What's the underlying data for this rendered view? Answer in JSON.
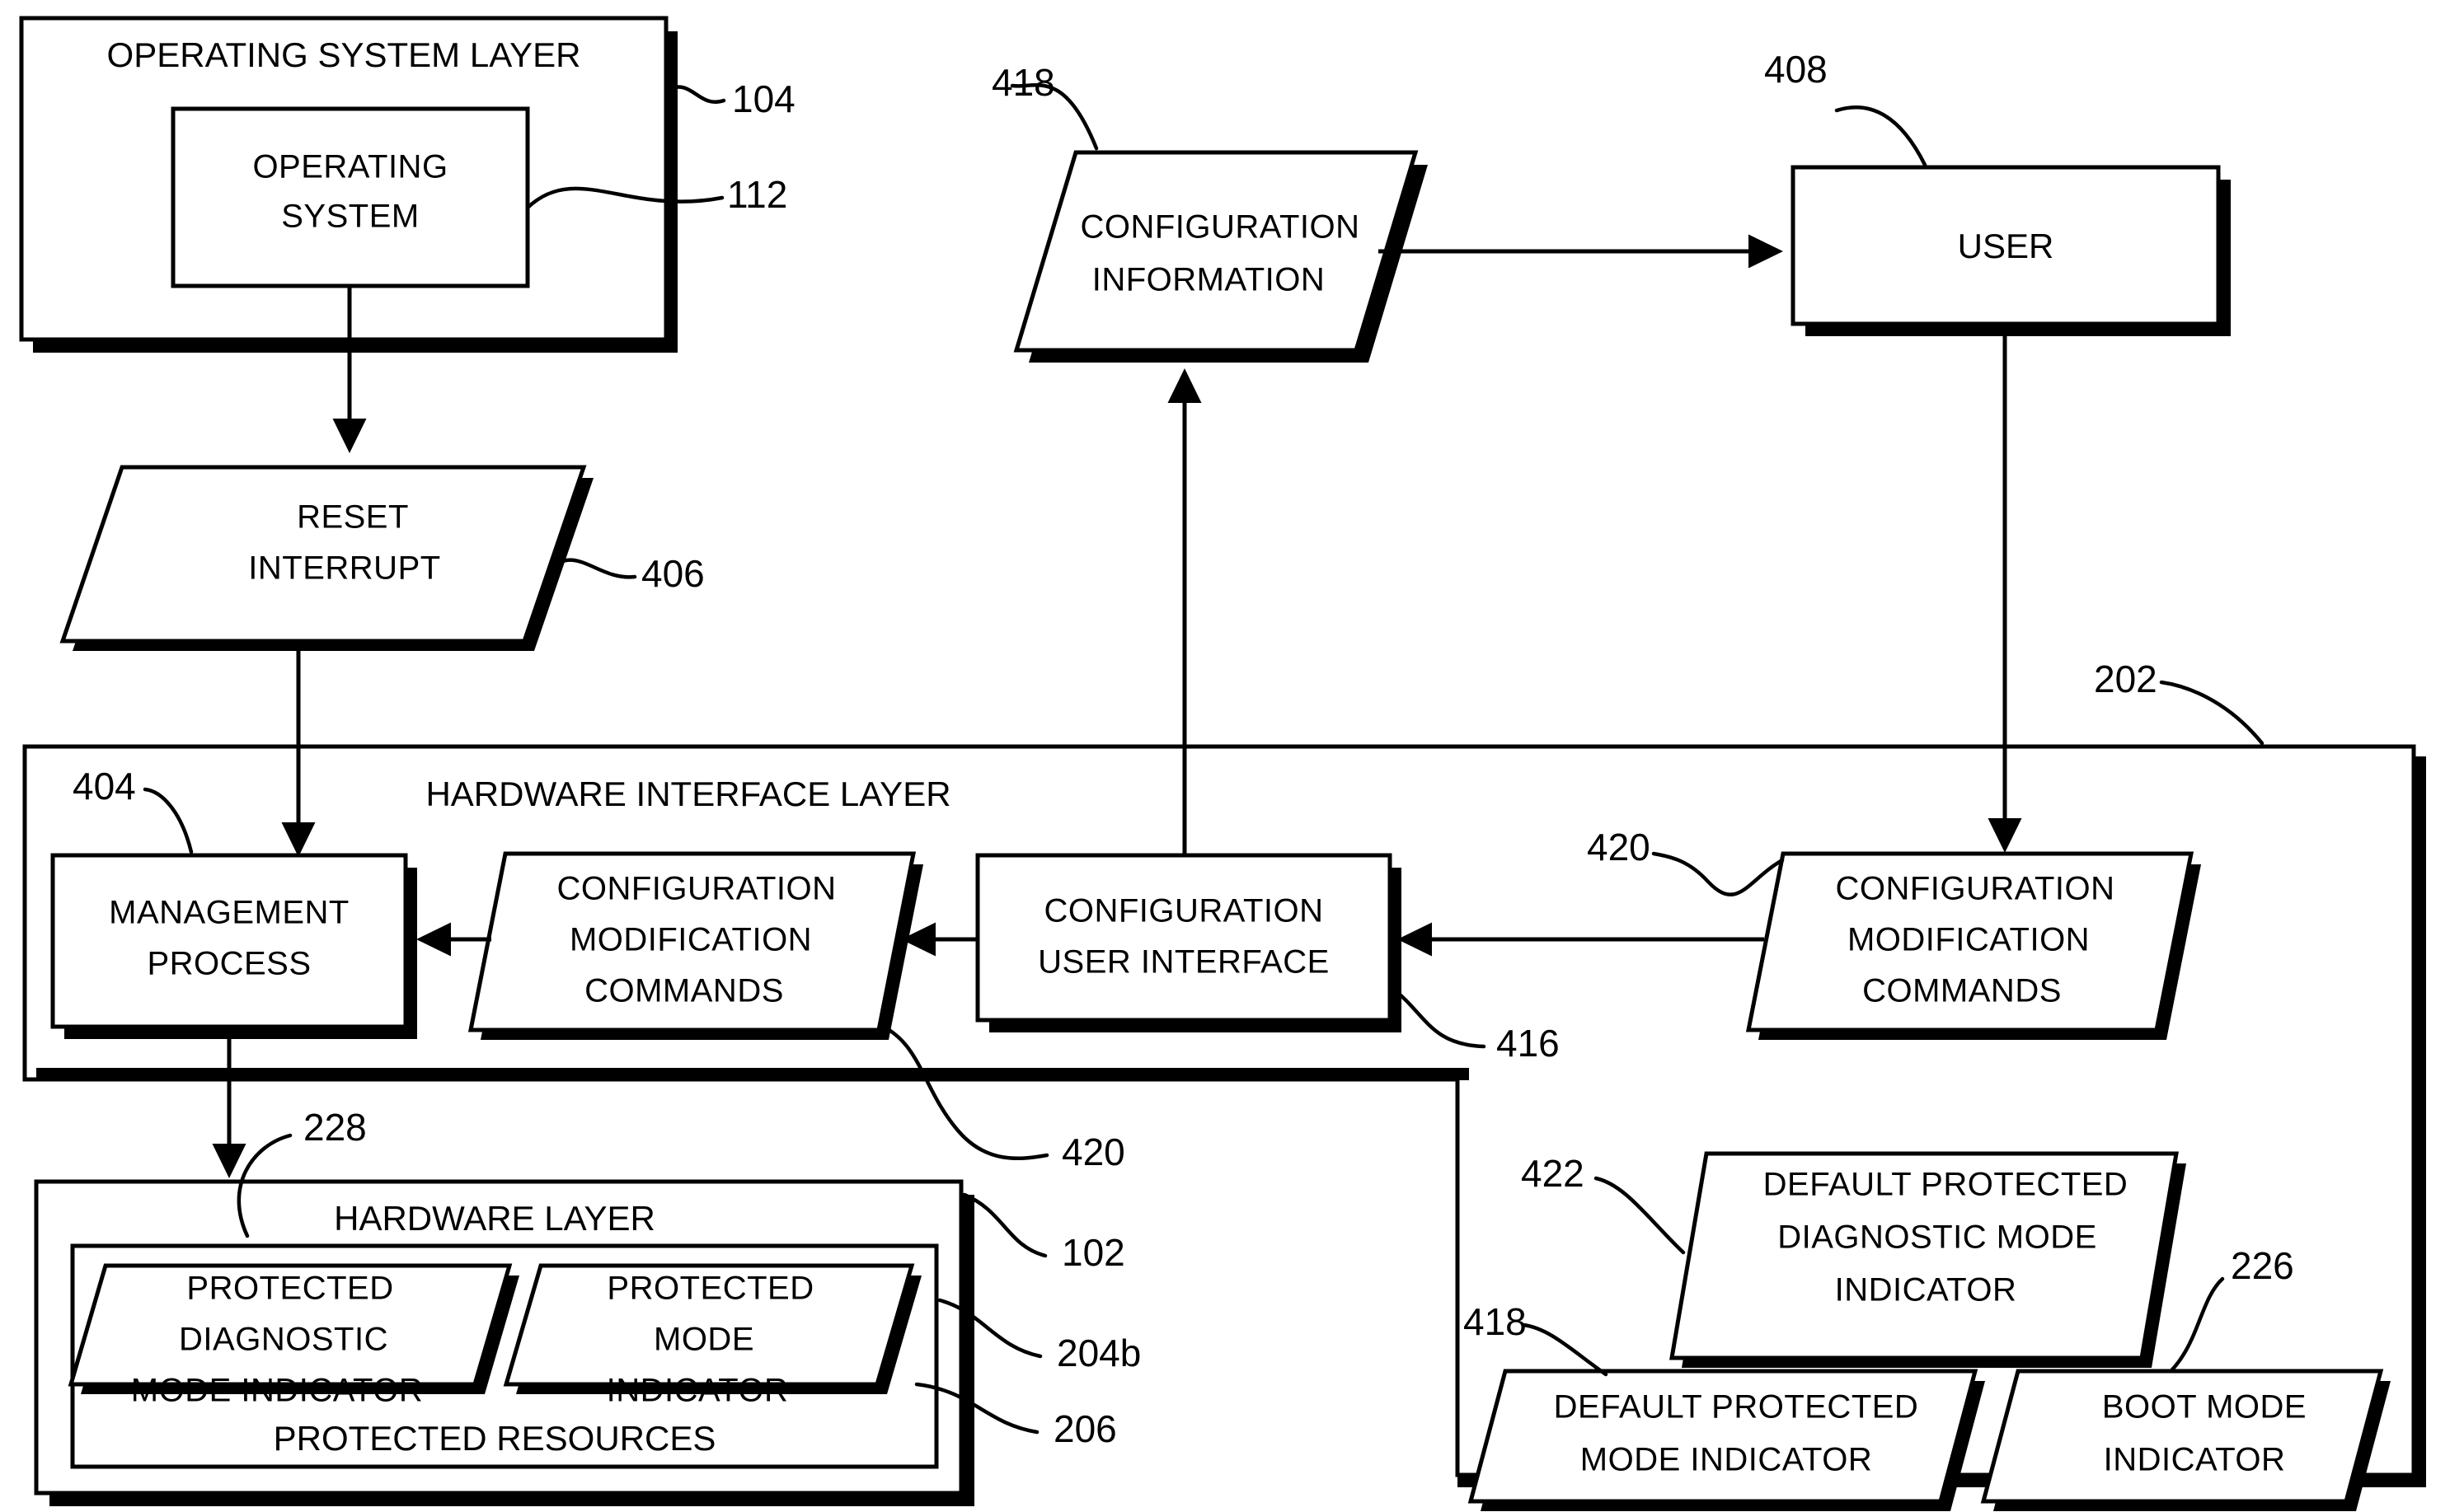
{
  "figure": {
    "type": "patent-block-diagram",
    "background_color": "#ffffff",
    "line_color": "#000000"
  },
  "blocks": {
    "operating_system_layer": {
      "label": "OPERATING SYSTEM LAYER",
      "ref": "104",
      "shape": "rectangle"
    },
    "operating_system": {
      "label_line1": "OPERATING",
      "label_line2": "SYSTEM",
      "ref": "112",
      "shape": "rectangle"
    },
    "reset_interrupt": {
      "label_line1": "RESET",
      "label_line2": "INTERRUPT",
      "ref": "406",
      "shape": "parallelogram"
    },
    "configuration_information": {
      "label_line1": "CONFIGURATION",
      "label_line2": "INFORMATION",
      "ref": "418",
      "shape": "parallelogram"
    },
    "user": {
      "label": "USER",
      "ref": "408",
      "shape": "rectangle"
    },
    "hardware_interface_layer": {
      "label": "HARDWARE INTERFACE LAYER",
      "shape": "rectangle"
    },
    "management_process": {
      "label_line1": "MANAGEMENT",
      "label_line2": "PROCESS",
      "ref": "404",
      "shape": "rectangle"
    },
    "configuration_modification_commands_inner": {
      "label_line1": "CONFIGURATION",
      "label_line2": "MODIFICATION",
      "label_line3": "COMMANDS",
      "ref": "420",
      "shape": "parallelogram"
    },
    "configuration_user_interface": {
      "label_line1": "CONFIGURATION",
      "label_line2": "USER INTERFACE",
      "ref": "416",
      "shape": "rectangle"
    },
    "configuration_modification_commands_outer": {
      "label_line1": "CONFIGURATION",
      "label_line2": "MODIFICATION",
      "label_line3": "COMMANDS",
      "ref": "420",
      "shape": "parallelogram"
    },
    "hardware_layer": {
      "label": "HARDWARE LAYER",
      "ref": "228",
      "shape": "rectangle"
    },
    "protected_resources": {
      "label": "PROTECTED RESOURCES",
      "ref": "102",
      "shape": "rectangle"
    },
    "protected_diagnostic_mode_indicator": {
      "label_line1": "PROTECTED",
      "label_line2": "DIAGNOSTIC",
      "label_line3": "MODE INDICATOR",
      "ref": "204b",
      "shape": "parallelogram"
    },
    "protected_mode_indicator": {
      "label_line1": "PROTECTED",
      "label_line2": "MODE",
      "label_line3": "INDICATOR",
      "ref": "206",
      "shape": "parallelogram"
    },
    "system_container": {
      "ref": "202",
      "shape": "rectangle"
    },
    "default_protected_diagnostic_mode_indicator": {
      "label_line1": "DEFAULT PROTECTED",
      "label_line2": "DIAGNOSTIC MODE",
      "label_line3": "INDICATOR",
      "ref": "422",
      "shape": "parallelogram"
    },
    "default_protected_mode_indicator": {
      "label_line1": "DEFAULT PROTECTED",
      "label_line2": "MODE INDICATOR",
      "ref": "418",
      "shape": "parallelogram"
    },
    "boot_mode_indicator": {
      "label_line1": "BOOT MODE",
      "label_line2": "INDICATOR",
      "ref": "226",
      "shape": "parallelogram"
    }
  },
  "reference_numerals": [
    "104",
    "112",
    "418",
    "408",
    "406",
    "202",
    "404",
    "420",
    "416",
    "228",
    "102",
    "204b",
    "206",
    "422",
    "226"
  ],
  "connections": [
    {
      "from": "operating_system",
      "to": "reset_interrupt",
      "style": "arrow-down"
    },
    {
      "from": "reset_interrupt",
      "to": "management_process",
      "style": "arrow-down"
    },
    {
      "from": "configuration_information",
      "to": "user",
      "style": "arrow-right"
    },
    {
      "from": "configuration_user_interface",
      "to": "configuration_information",
      "style": "arrow-up"
    },
    {
      "from": "user",
      "to": "configuration_modification_commands_outer",
      "style": "arrow-down"
    },
    {
      "from": "configuration_modification_commands_outer",
      "to": "configuration_user_interface",
      "style": "arrow-left"
    },
    {
      "from": "configuration_user_interface",
      "to": "configuration_modification_commands_inner",
      "style": "arrow-left"
    },
    {
      "from": "configuration_modification_commands_inner",
      "to": "management_process",
      "style": "arrow-left"
    },
    {
      "from": "management_process",
      "to": "hardware_layer",
      "style": "arrow-down"
    }
  ]
}
